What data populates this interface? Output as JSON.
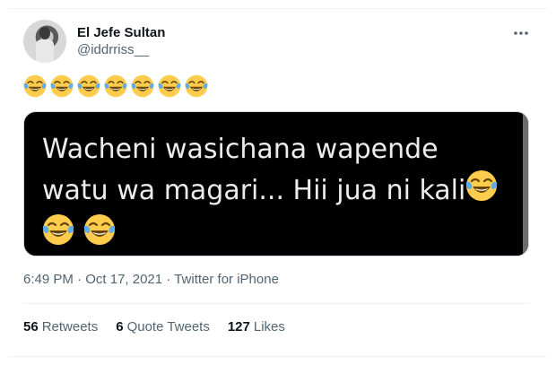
{
  "author": {
    "display_name": "El Jefe Sultan",
    "handle": "@iddrriss__"
  },
  "tweet": {
    "emoji_count": 7,
    "emoji_icon": "face-with-tears-of-joy-icon"
  },
  "media": {
    "line1": "Wacheni wasichana wapende",
    "line2": "watu wa magari... Hii jua ni kali"
  },
  "meta": {
    "time": "6:49 PM",
    "separator1": " · ",
    "date": "Oct 17, 2021",
    "separator2": " · ",
    "source": "Twitter for iPhone"
  },
  "stats": {
    "retweets_count": "56",
    "retweets_label": "Retweets",
    "quotes_count": "6",
    "quotes_label": "Quote Tweets",
    "likes_count": "127",
    "likes_label": "Likes"
  },
  "colors": {
    "primary_text": "#0f1419",
    "secondary_text": "#536471",
    "media_background": "#000000",
    "emoji_yellow": "#ffcc4d",
    "emoji_tears": "#5dadec"
  }
}
